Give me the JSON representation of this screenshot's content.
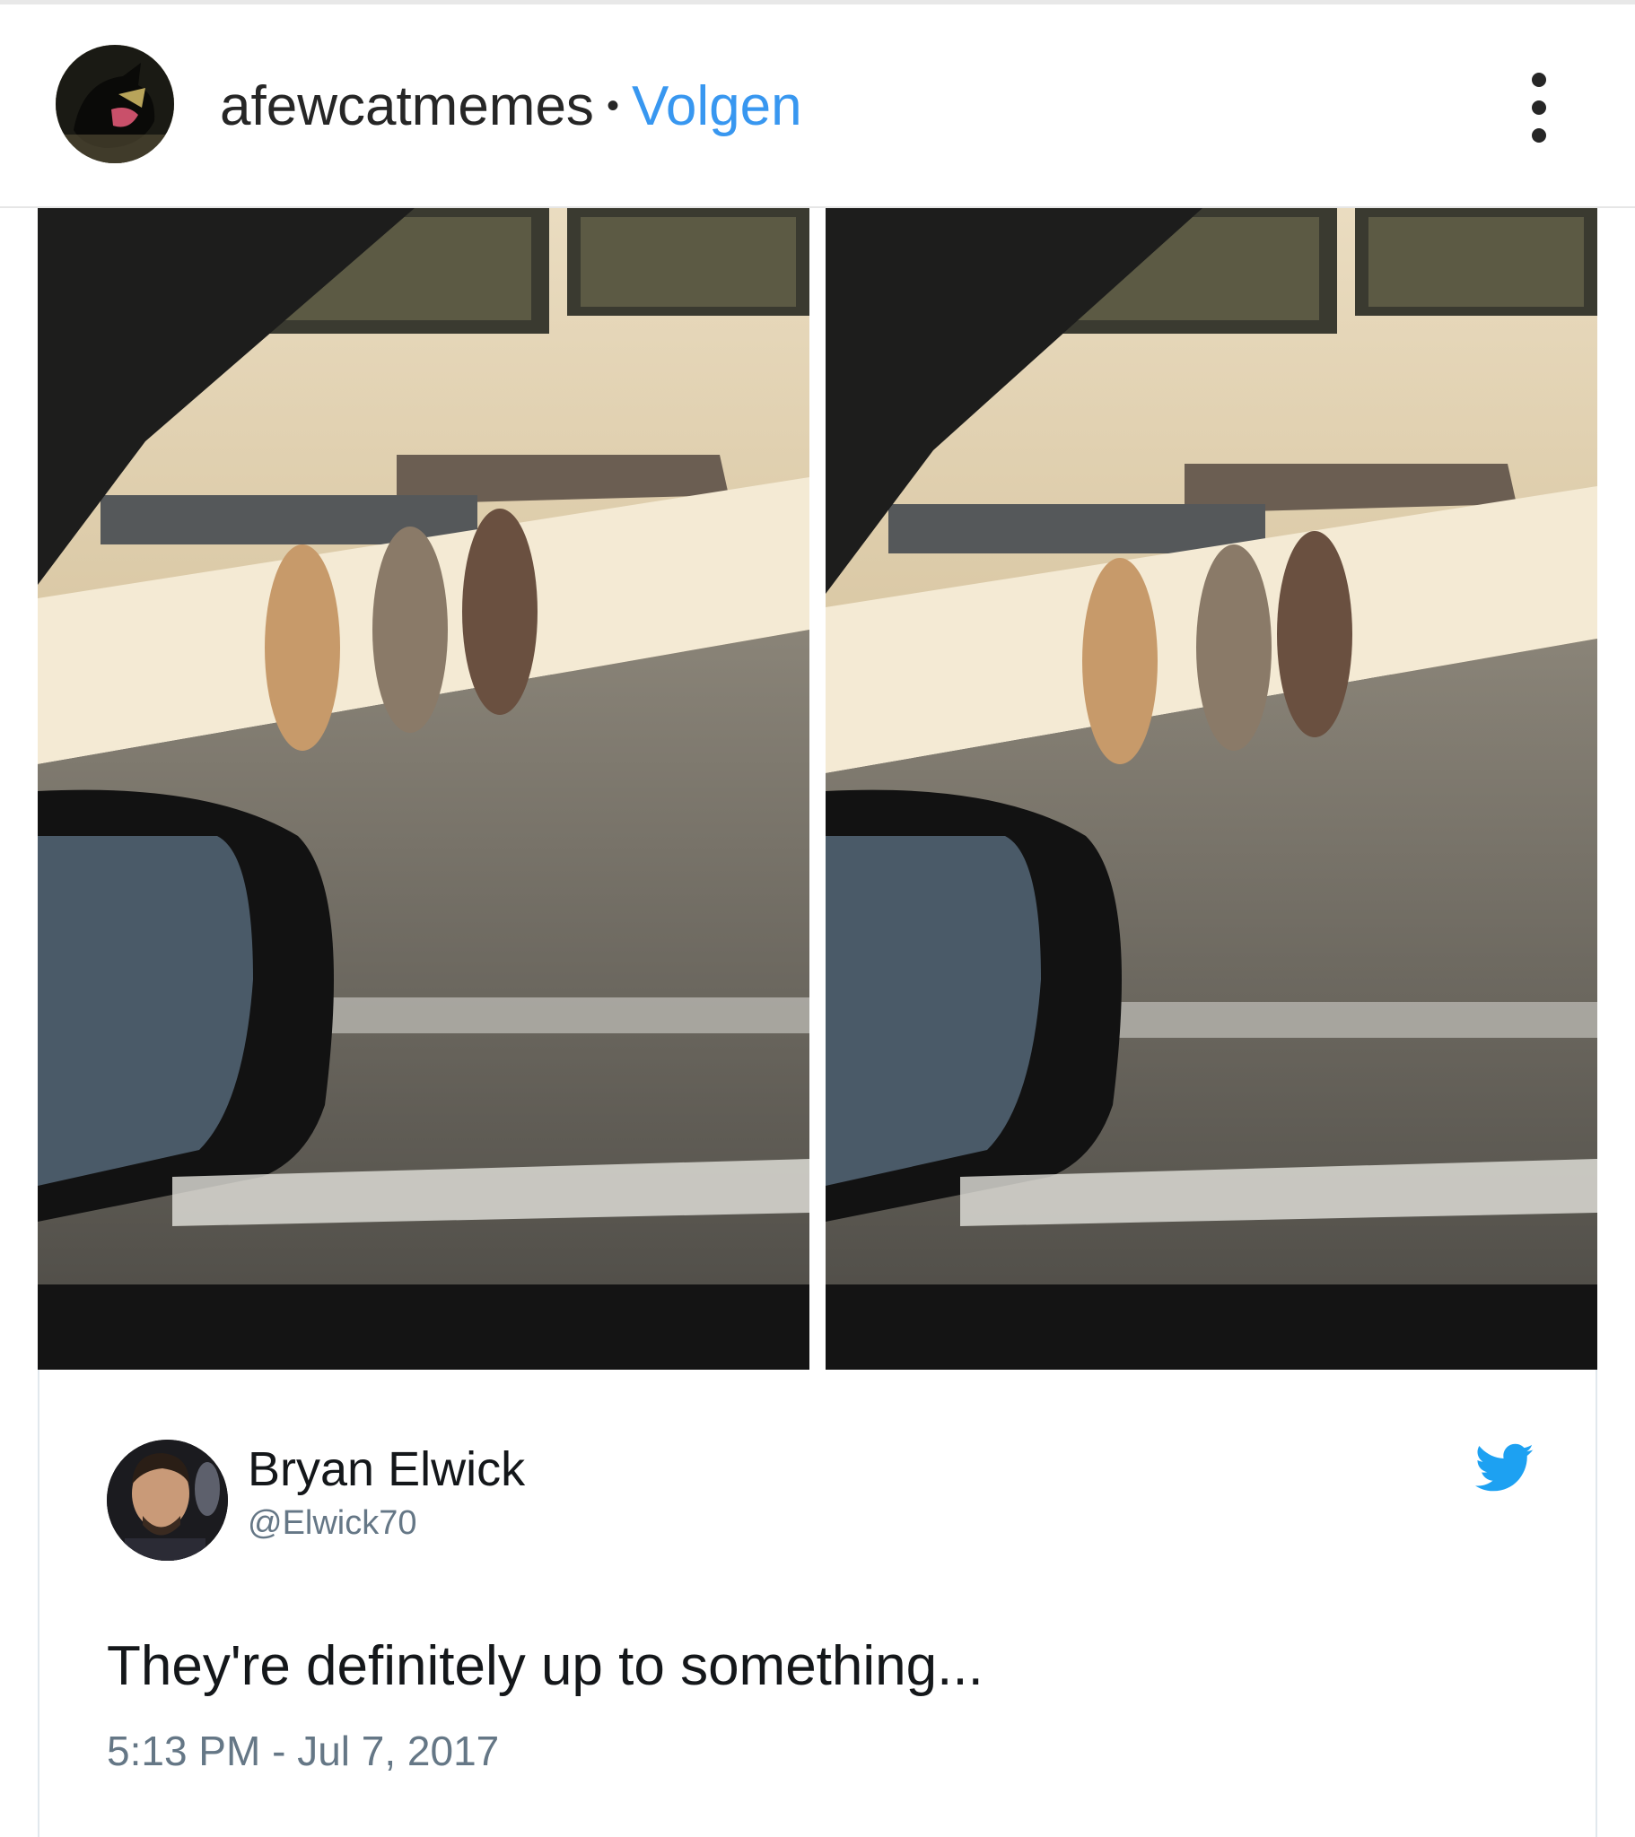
{
  "post_header": {
    "username": "afewcatmemes",
    "separator": "•",
    "follow_label": "Volgen",
    "avatar_icon": "black-cat-avatar-icon",
    "more_icon": "more-options-icon"
  },
  "photos": [
    {
      "description_icon": "cats-on-wall-photo-left"
    },
    {
      "description_icon": "cats-on-wall-photo-right"
    }
  ],
  "tweet": {
    "author_name": "Bryan Elwick",
    "author_handle": "@Elwick70",
    "text": "They're definitely up to something...",
    "timestamp": "5:13 PM - Jul 7, 2017",
    "platform_icon": "twitter-bird-icon"
  },
  "colors": {
    "follow_blue": "#3897f0",
    "twitter_blue": "#1da1f2",
    "text_dark": "#262626",
    "text_muted": "#657786"
  }
}
